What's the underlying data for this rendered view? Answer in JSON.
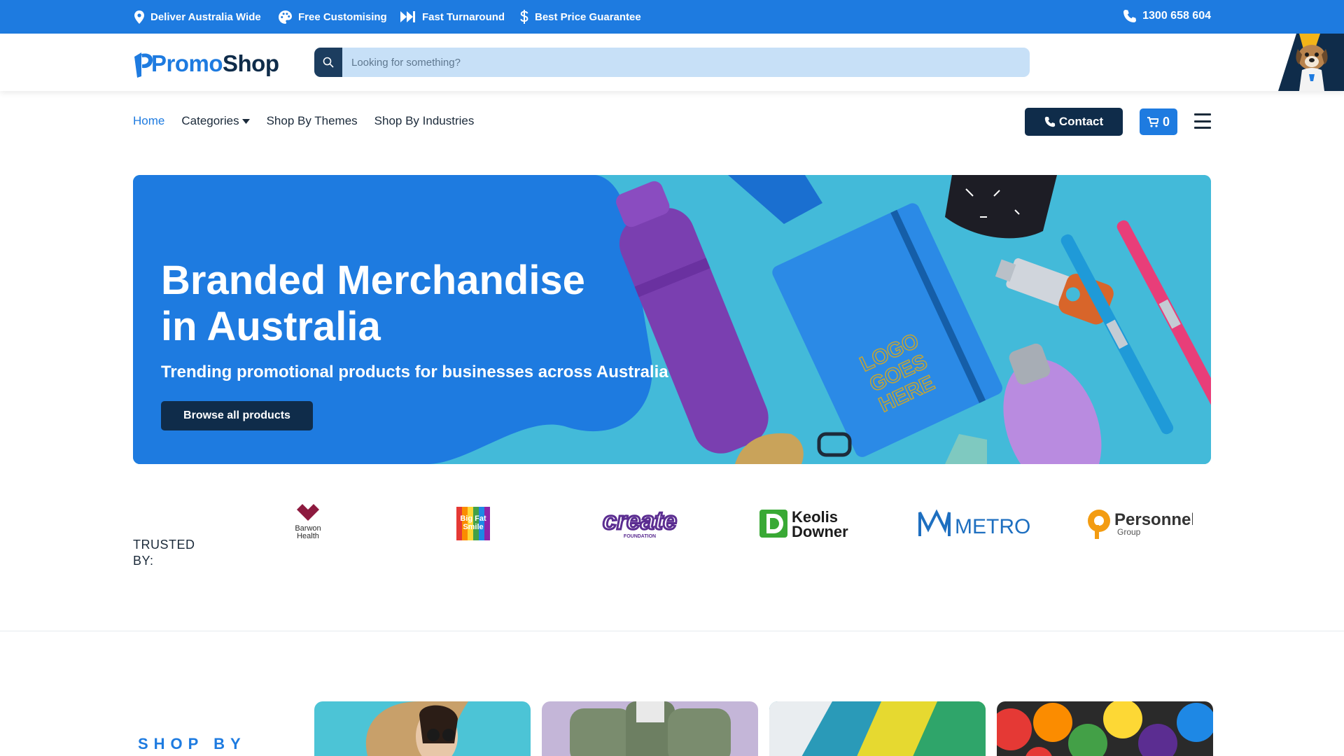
{
  "topbar": {
    "usps": [
      {
        "label": "Deliver Australia Wide",
        "icon": "map-pin-icon"
      },
      {
        "label": "Free Customising",
        "icon": "palette-icon"
      },
      {
        "label": "Fast Turnaround",
        "icon": "fast-forward-icon"
      },
      {
        "label": "Best Price Guarantee",
        "icon": "dollar-icon"
      }
    ],
    "phone": "1300 658 604"
  },
  "header": {
    "logo_part1": "Promo",
    "logo_part2": "Shop",
    "search_placeholder": "Looking for something?"
  },
  "nav": {
    "items": [
      "Home",
      "Categories",
      "Shop By Themes",
      "Shop By Industries"
    ],
    "active": "Home",
    "contact_label": "Contact",
    "cart_count": "0"
  },
  "hero": {
    "title_line1": "Branded Merchandise",
    "title_line2": "in Australia",
    "subtitle": "Trending promotional products for businesses across Australia",
    "cta": "Browse all products",
    "notebook_text": "LOGO GOES HERE"
  },
  "trusted": {
    "label": "TRUSTED BY:",
    "brands": [
      {
        "line1": "Barwon",
        "line2": "Health"
      },
      {
        "line1": "Big Fat",
        "line2": "Smile"
      },
      {
        "line1": "create",
        "line2": "FOUNDATION"
      },
      {
        "line1": "Keolis",
        "line2": "Downer"
      },
      {
        "line1": "METRO",
        "line2": ""
      },
      {
        "line1": "Personnel",
        "line2": "Group"
      }
    ]
  },
  "shop_by": {
    "label": "SHOP BY"
  },
  "colors": {
    "brand_blue": "#1e7be0",
    "navy": "#0f2c4a",
    "search_bg": "#c7e0f7",
    "hero_teal": "#3fb6d8"
  }
}
